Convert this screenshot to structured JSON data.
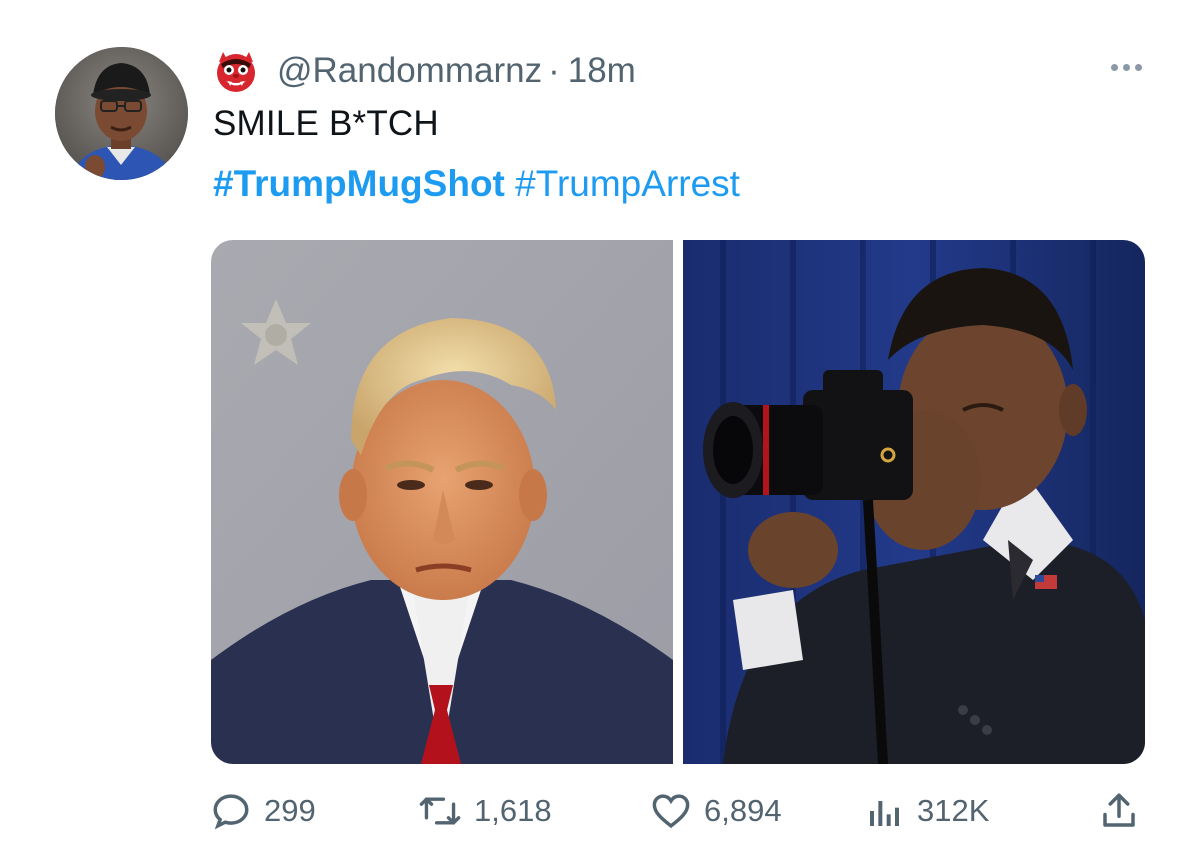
{
  "tweet": {
    "handle": "@Randommarnz",
    "separator": "·",
    "time": "18m",
    "name_emoji_icon": "ogre-emoji-icon",
    "text": "SMILE B*TCH",
    "hashtag_1": "#TrumpMugShot",
    "hashtag_2": "#TrumpArrest",
    "media": [
      {
        "description_icon": "mugshot-photo"
      },
      {
        "description_icon": "photographer-camera-photo"
      }
    ]
  },
  "actions": {
    "replies": "299",
    "retweets": "1,618",
    "likes": "6,894",
    "views": "312K"
  },
  "colors": {
    "link": "#1d9bf0",
    "secondary_text": "#536471",
    "primary_text": "#0f1419"
  }
}
